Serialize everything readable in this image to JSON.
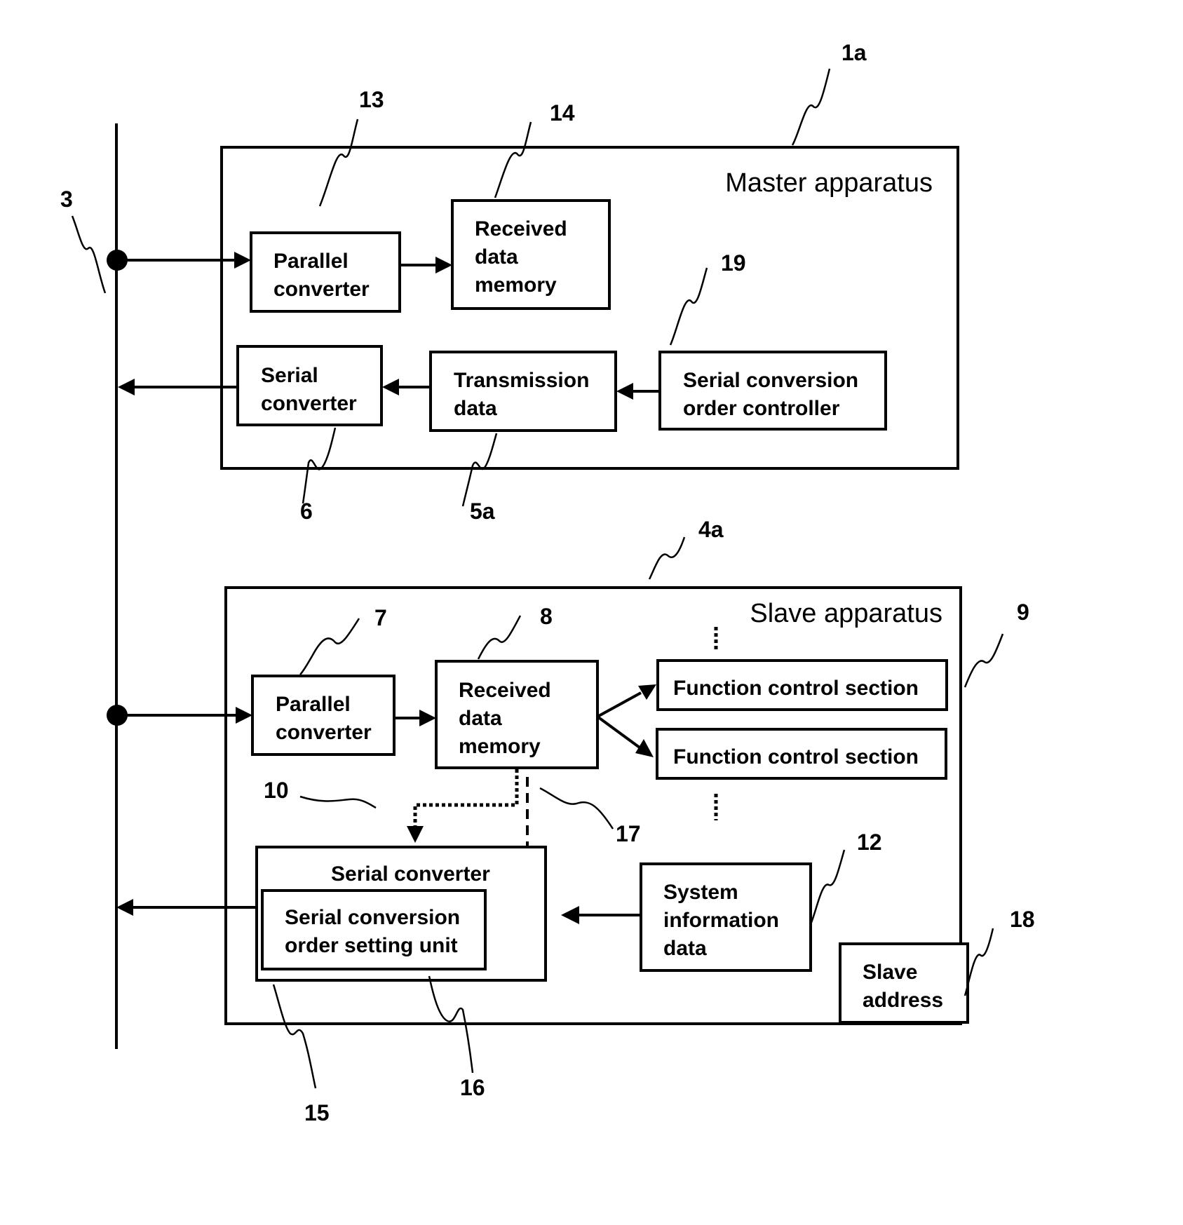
{
  "figure": {
    "master": {
      "title": "Master apparatus",
      "ref": "1a",
      "parallel_converter": [
        "Parallel",
        "converter"
      ],
      "parallel_converter_ref": "13",
      "received_data_memory": [
        "Received",
        "data",
        "memory"
      ],
      "received_data_memory_ref": "14",
      "serial_converter": [
        "Serial",
        "converter"
      ],
      "serial_converter_ref": "6",
      "transmission_data": [
        "Transmission",
        "data"
      ],
      "transmission_data_ref": "5a",
      "serial_conversion_order_controller": [
        "Serial conversion",
        "order controller"
      ],
      "serial_conversion_order_controller_ref": "19"
    },
    "bus": {
      "ref": "3"
    },
    "slave": {
      "title": "Slave apparatus",
      "ref": "4a",
      "parallel_converter": [
        "Parallel",
        "converter"
      ],
      "parallel_converter_ref": "7",
      "received_data_memory": [
        "Received",
        "data",
        "memory"
      ],
      "received_data_memory_ref": "8",
      "function_control_sections": [
        "Function control section",
        "Function control section"
      ],
      "function_control_ref": "9",
      "path_ref_10": "10",
      "path_ref_17": "17",
      "serial_converter": "Serial converter",
      "serial_converter_ref": "15",
      "order_setting_unit": [
        "Serial conversion",
        "order setting unit"
      ],
      "order_setting_unit_ref": "16",
      "system_information_data": [
        "System",
        "information",
        "data"
      ],
      "system_information_data_ref": "12",
      "slave_address": [
        "Slave",
        "address"
      ],
      "slave_address_ref": "18"
    }
  }
}
